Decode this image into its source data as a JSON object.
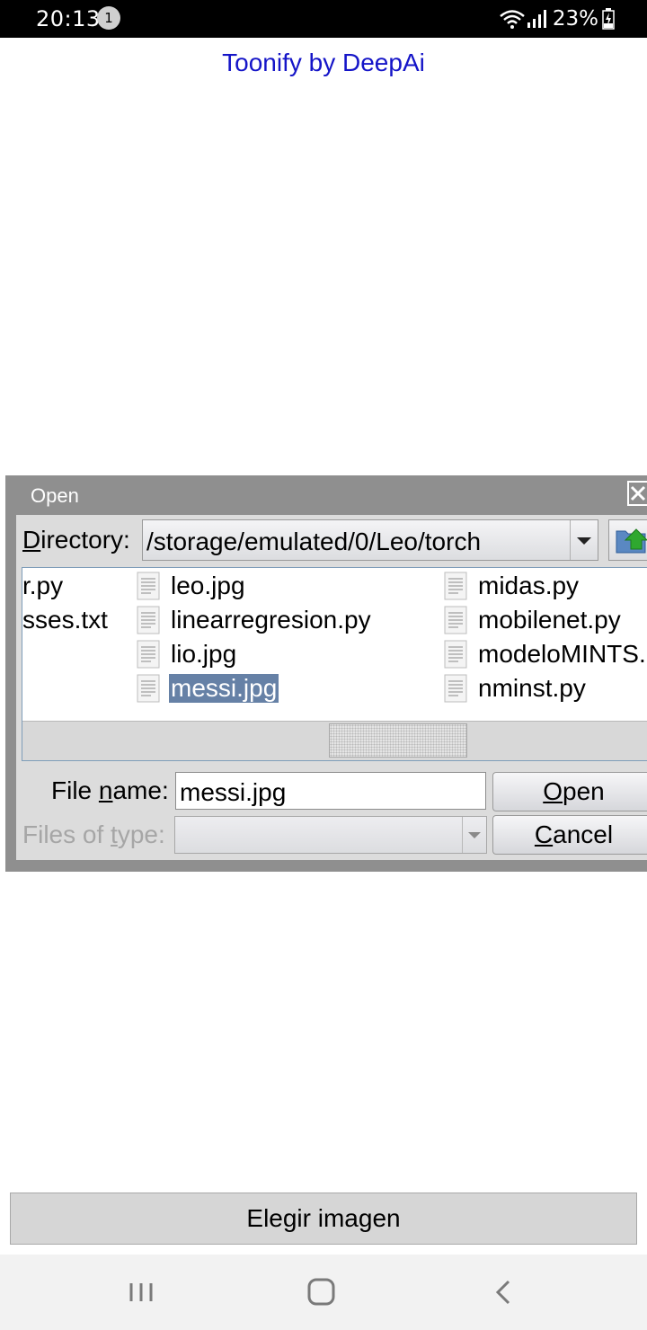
{
  "status_bar": {
    "time": "20:13",
    "notification_count": "1",
    "battery_percent": "23%",
    "icons": [
      "wifi-icon",
      "signal-icon",
      "battery-charging-icon"
    ]
  },
  "app": {
    "title": "Toonify by DeepAi",
    "title_color": "#1515c8"
  },
  "dialog": {
    "title": "Open",
    "directory_label_underlined": "D",
    "directory_label_rest": "irectory:",
    "directory_path": "/storage/emulated/0/Leo/torch",
    "files": {
      "column1": [
        "r.py",
        "sses.txt"
      ],
      "column2": [
        "leo.jpg",
        "linearregresion.py",
        "lio.jpg",
        "messi.jpg"
      ],
      "column3": [
        "midas.py",
        "mobilenet.py",
        "modeloMINTS.",
        "nminst.py"
      ]
    },
    "selected_file": "messi.jpg",
    "selection_color": "#6681a6",
    "file_name_label_pre": "File ",
    "file_name_label_underlined": "n",
    "file_name_label_post": "ame:",
    "file_name_value": "messi.jpg",
    "files_of_type_label_pre": "Files of ",
    "files_of_type_label_underlined": "t",
    "files_of_type_label_post": "ype:",
    "open_button_underlined": "O",
    "open_button_rest": "pen",
    "cancel_button_underlined": "C",
    "cancel_button_rest": "ancel"
  },
  "choose_image_button": "Elegir imagen",
  "nav_bar": {
    "icons": [
      "recent-apps-icon",
      "home-icon",
      "back-icon"
    ]
  }
}
